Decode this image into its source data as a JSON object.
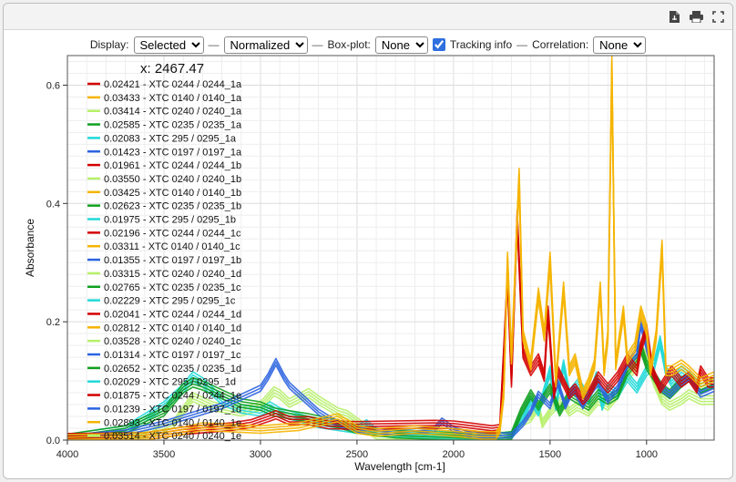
{
  "toolbar": {
    "display_label": "Display:",
    "display_value": "Selected",
    "sep1": "—",
    "mode_value": "Normalized",
    "sep2": "—",
    "boxplot_label": "Box-plot:",
    "boxplot_value": "None",
    "tracking_label": "Tracking info",
    "sep3": "—",
    "correlation_label": "Correlation:",
    "correlation_value": "None"
  },
  "icons": [
    "pdf-export-icon",
    "print-icon",
    "fullscreen-icon"
  ],
  "tracking": {
    "readout": "x: 2467.47"
  },
  "chart_data": {
    "type": "line",
    "xlabel": "Wavelength [cm-1]",
    "ylabel": "Absorbance",
    "xlim": [
      4000,
      650
    ],
    "ylim": [
      0,
      0.65
    ],
    "x_reversed": true,
    "grid": true,
    "legend_position": "top-left",
    "x_ticks": [
      4000,
      3500,
      3000,
      2500,
      2000,
      1500,
      1000
    ],
    "y_ticks": [
      0.0,
      0.2,
      0.4,
      0.6
    ],
    "series": [
      {
        "name": "0.02421 - XTC 0244 / 0244_1a",
        "color": "#d40000"
      },
      {
        "name": "0.03433 - XTC 0140 / 0140_1a",
        "color": "#f5b400"
      },
      {
        "name": "0.03414 - XTC 0240 / 0240_1a",
        "color": "#b7f06a"
      },
      {
        "name": "0.02585 - XTC 0235 / 0235_1a",
        "color": "#10a020"
      },
      {
        "name": "0.02083 - XTC 295 / 0295_1a",
        "color": "#20d8d8"
      },
      {
        "name": "0.01423 - XTC 0197 / 0197_1a",
        "color": "#2b63e0"
      },
      {
        "name": "0.01961 - XTC 0244 / 0244_1b",
        "color": "#d40000"
      },
      {
        "name": "0.03550 - XTC 0240 / 0240_1b",
        "color": "#b7f06a"
      },
      {
        "name": "0.03425 - XTC 0140 / 0140_1b",
        "color": "#f5b400"
      },
      {
        "name": "0.02623 - XTC 0235 / 0235_1b",
        "color": "#10a020"
      },
      {
        "name": "0.01975 - XTC 295 / 0295_1b",
        "color": "#20d8d8"
      },
      {
        "name": "0.02196 - XTC 0244 / 0244_1c",
        "color": "#d40000"
      },
      {
        "name": "0.03311 - XTC 0140 / 0140_1c",
        "color": "#f5b400"
      },
      {
        "name": "0.01355 - XTC 0197 / 0197_1b",
        "color": "#2b63e0"
      },
      {
        "name": "0.03315 - XTC 0240 / 0240_1d",
        "color": "#b7f06a"
      },
      {
        "name": "0.02765 - XTC 0235 / 0235_1c",
        "color": "#10a020"
      },
      {
        "name": "0.02229 - XTC 295 / 0295_1c",
        "color": "#20d8d8"
      },
      {
        "name": "0.02041 - XTC 0244 / 0244_1d",
        "color": "#d40000"
      },
      {
        "name": "0.02812 - XTC 0140 / 0140_1d",
        "color": "#f5b400"
      },
      {
        "name": "0.03528 - XTC 0240 / 0240_1c",
        "color": "#b7f06a"
      },
      {
        "name": "0.01314 - XTC 0197 / 0197_1c",
        "color": "#2b63e0"
      },
      {
        "name": "0.02652 - XTC 0235 / 0235_1d",
        "color": "#10a020"
      },
      {
        "name": "0.02029 - XTC 295 / 0295_1d",
        "color": "#20d8d8"
      },
      {
        "name": "0.01875 - XTC 0244 / 0244_1e",
        "color": "#d40000"
      },
      {
        "name": "0.01239 - XTC 0197 / 0197_1d",
        "color": "#2b63e0"
      },
      {
        "name": "0.02893 - XTC 0140 / 0140_1e",
        "color": "#f5b400"
      },
      {
        "name": "0.03514 - XTC 0240 / 0240_1e",
        "color": "#b7f06a"
      }
    ],
    "group_spectra": {
      "red": [
        [
          4000,
          0.007
        ],
        [
          3600,
          0.008
        ],
        [
          3400,
          0.018
        ],
        [
          3150,
          0.025
        ],
        [
          3050,
          0.03
        ],
        [
          2960,
          0.04
        ],
        [
          2920,
          0.045
        ],
        [
          2850,
          0.035
        ],
        [
          2750,
          0.035
        ],
        [
          2650,
          0.028
        ],
        [
          2500,
          0.027
        ],
        [
          2300,
          0.028
        ],
        [
          2100,
          0.029
        ],
        [
          2000,
          0.028
        ],
        [
          1900,
          0.024
        ],
        [
          1800,
          0.02
        ],
        [
          1760,
          0.022
        ],
        [
          1740,
          0.15
        ],
        [
          1720,
          0.28
        ],
        [
          1700,
          0.1
        ],
        [
          1670,
          0.38
        ],
        [
          1640,
          0.15
        ],
        [
          1600,
          0.12
        ],
        [
          1560,
          0.14
        ],
        [
          1530,
          0.11
        ],
        [
          1510,
          0.22
        ],
        [
          1480,
          0.08
        ],
        [
          1460,
          0.12
        ],
        [
          1400,
          0.08
        ],
        [
          1370,
          0.09
        ],
        [
          1330,
          0.07
        ],
        [
          1300,
          0.08
        ],
        [
          1250,
          0.11
        ],
        [
          1200,
          0.09
        ],
        [
          1150,
          0.11
        ],
        [
          1100,
          0.14
        ],
        [
          1050,
          0.12
        ],
        [
          1030,
          0.16
        ],
        [
          1000,
          0.19
        ],
        [
          970,
          0.12
        ],
        [
          930,
          0.09
        ],
        [
          870,
          0.12
        ],
        [
          820,
          0.1
        ],
        [
          780,
          0.11
        ],
        [
          740,
          0.09
        ],
        [
          720,
          0.12
        ],
        [
          680,
          0.1
        ],
        [
          650,
          0.1
        ]
      ],
      "yellow": [
        [
          4000,
          0.005
        ],
        [
          3600,
          0.008
        ],
        [
          3400,
          0.018
        ],
        [
          3300,
          0.025
        ],
        [
          3000,
          0.02
        ],
        [
          2800,
          0.025
        ],
        [
          2600,
          0.04
        ],
        [
          2500,
          0.02
        ],
        [
          2400,
          0.015
        ],
        [
          2200,
          0.02
        ],
        [
          2000,
          0.015
        ],
        [
          1850,
          0.01
        ],
        [
          1780,
          0.01
        ],
        [
          1760,
          0.02
        ],
        [
          1740,
          0.08
        ],
        [
          1720,
          0.31
        ],
        [
          1700,
          0.14
        ],
        [
          1660,
          0.45
        ],
        [
          1640,
          0.18
        ],
        [
          1600,
          0.13
        ],
        [
          1560,
          0.25
        ],
        [
          1530,
          0.18
        ],
        [
          1500,
          0.31
        ],
        [
          1470,
          0.1
        ],
        [
          1430,
          0.26
        ],
        [
          1400,
          0.12
        ],
        [
          1370,
          0.14
        ],
        [
          1330,
          0.08
        ],
        [
          1300,
          0.1
        ],
        [
          1270,
          0.13
        ],
        [
          1240,
          0.26
        ],
        [
          1220,
          0.12
        ],
        [
          1200,
          0.18
        ],
        [
          1180,
          0.64
        ],
        [
          1160,
          0.13
        ],
        [
          1120,
          0.22
        ],
        [
          1100,
          0.14
        ],
        [
          1060,
          0.16
        ],
        [
          1030,
          0.22
        ],
        [
          1000,
          0.19
        ],
        [
          980,
          0.12
        ],
        [
          950,
          0.18
        ],
        [
          920,
          0.33
        ],
        [
          900,
          0.12
        ],
        [
          870,
          0.12
        ],
        [
          820,
          0.13
        ],
        [
          780,
          0.12
        ],
        [
          720,
          0.1
        ],
        [
          650,
          0.11
        ]
      ],
      "lime": [
        [
          4000,
          0.005
        ],
        [
          3600,
          0.01
        ],
        [
          3450,
          0.03
        ],
        [
          3350,
          0.075
        ],
        [
          3250,
          0.06
        ],
        [
          3100,
          0.05
        ],
        [
          3000,
          0.06
        ],
        [
          2930,
          0.085
        ],
        [
          2900,
          0.08
        ],
        [
          2850,
          0.065
        ],
        [
          2750,
          0.082
        ],
        [
          2700,
          0.07
        ],
        [
          2600,
          0.05
        ],
        [
          2550,
          0.045
        ],
        [
          2400,
          0.01
        ],
        [
          2200,
          0.01
        ],
        [
          2000,
          0.01
        ],
        [
          1800,
          0.008
        ],
        [
          1700,
          0.01
        ],
        [
          1660,
          0.03
        ],
        [
          1600,
          0.04
        ],
        [
          1560,
          0.06
        ],
        [
          1540,
          0.03
        ],
        [
          1500,
          0.05
        ],
        [
          1440,
          0.07
        ],
        [
          1400,
          0.05
        ],
        [
          1360,
          0.06
        ],
        [
          1300,
          0.05
        ],
        [
          1250,
          0.07
        ],
        [
          1200,
          0.06
        ],
        [
          1150,
          0.08
        ],
        [
          1100,
          0.11
        ],
        [
          1050,
          0.13
        ],
        [
          1030,
          0.16
        ],
        [
          1000,
          0.14
        ],
        [
          960,
          0.1
        ],
        [
          920,
          0.07
        ],
        [
          880,
          0.06
        ],
        [
          820,
          0.07
        ],
        [
          780,
          0.08
        ],
        [
          720,
          0.07
        ],
        [
          650,
          0.07
        ]
      ],
      "green": [
        [
          4000,
          0.006
        ],
        [
          3700,
          0.02
        ],
        [
          3500,
          0.05
        ],
        [
          3400,
          0.09
        ],
        [
          3350,
          0.1
        ],
        [
          3300,
          0.095
        ],
        [
          3200,
          0.08
        ],
        [
          3100,
          0.065
        ],
        [
          3000,
          0.06
        ],
        [
          2930,
          0.05
        ],
        [
          2850,
          0.045
        ],
        [
          2750,
          0.04
        ],
        [
          2600,
          0.03
        ],
        [
          2500,
          0.02
        ],
        [
          2300,
          0.012
        ],
        [
          2000,
          0.008
        ],
        [
          1800,
          0.006
        ],
        [
          1700,
          0.01
        ],
        [
          1650,
          0.05
        ],
        [
          1600,
          0.08
        ],
        [
          1560,
          0.06
        ],
        [
          1500,
          0.09
        ],
        [
          1450,
          0.05
        ],
        [
          1400,
          0.08
        ],
        [
          1350,
          0.07
        ],
        [
          1300,
          0.06
        ],
        [
          1250,
          0.08
        ],
        [
          1200,
          0.07
        ],
        [
          1150,
          0.08
        ],
        [
          1100,
          0.12
        ],
        [
          1050,
          0.14
        ],
        [
          1030,
          0.16
        ],
        [
          1000,
          0.13
        ],
        [
          960,
          0.11
        ],
        [
          920,
          0.09
        ],
        [
          880,
          0.08
        ],
        [
          820,
          0.1
        ],
        [
          780,
          0.11
        ],
        [
          720,
          0.09
        ],
        [
          650,
          0.1
        ]
      ],
      "cyan": [
        [
          4000,
          0.006
        ],
        [
          3700,
          0.02
        ],
        [
          3500,
          0.06
        ],
        [
          3400,
          0.09
        ],
        [
          3350,
          0.11
        ],
        [
          3300,
          0.1
        ],
        [
          3200,
          0.07
        ],
        [
          3100,
          0.055
        ],
        [
          3000,
          0.05
        ],
        [
          2950,
          0.06
        ],
        [
          2900,
          0.05
        ],
        [
          2800,
          0.04
        ],
        [
          2700,
          0.03
        ],
        [
          2500,
          0.02
        ],
        [
          2450,
          0.03
        ],
        [
          2400,
          0.015
        ],
        [
          2200,
          0.012
        ],
        [
          2000,
          0.01
        ],
        [
          1800,
          0.006
        ],
        [
          1700,
          0.01
        ],
        [
          1640,
          0.04
        ],
        [
          1600,
          0.07
        ],
        [
          1560,
          0.05
        ],
        [
          1500,
          0.12
        ],
        [
          1470,
          0.06
        ],
        [
          1430,
          0.13
        ],
        [
          1400,
          0.08
        ],
        [
          1350,
          0.1
        ],
        [
          1300,
          0.07
        ],
        [
          1260,
          0.11
        ],
        [
          1230,
          0.06
        ],
        [
          1200,
          0.09
        ],
        [
          1150,
          0.08
        ],
        [
          1100,
          0.11
        ],
        [
          1050,
          0.09
        ],
        [
          1000,
          0.12
        ],
        [
          960,
          0.13
        ],
        [
          930,
          0.17
        ],
        [
          900,
          0.12
        ],
        [
          870,
          0.1
        ],
        [
          820,
          0.12
        ],
        [
          780,
          0.11
        ],
        [
          720,
          0.09
        ],
        [
          650,
          0.1
        ]
      ],
      "blue": [
        [
          4000,
          0.006
        ],
        [
          3700,
          0.015
        ],
        [
          3500,
          0.03
        ],
        [
          3300,
          0.05
        ],
        [
          3200,
          0.06
        ],
        [
          3100,
          0.075
        ],
        [
          3000,
          0.09
        ],
        [
          2960,
          0.11
        ],
        [
          2920,
          0.135
        ],
        [
          2880,
          0.11
        ],
        [
          2850,
          0.095
        ],
        [
          2800,
          0.08
        ],
        [
          2700,
          0.05
        ],
        [
          2600,
          0.03
        ],
        [
          2500,
          0.02
        ],
        [
          2300,
          0.015
        ],
        [
          2100,
          0.02
        ],
        [
          2060,
          0.035
        ],
        [
          2000,
          0.02
        ],
        [
          1900,
          0.01
        ],
        [
          1700,
          0.01
        ],
        [
          1640,
          0.03
        ],
        [
          1600,
          0.05
        ],
        [
          1560,
          0.08
        ],
        [
          1500,
          0.06
        ],
        [
          1460,
          0.1
        ],
        [
          1420,
          0.06
        ],
        [
          1380,
          0.09
        ],
        [
          1330,
          0.06
        ],
        [
          1300,
          0.08
        ],
        [
          1250,
          0.1
        ],
        [
          1200,
          0.07
        ],
        [
          1150,
          0.09
        ],
        [
          1100,
          0.13
        ],
        [
          1050,
          0.15
        ],
        [
          1030,
          0.2
        ],
        [
          1000,
          0.16
        ],
        [
          960,
          0.11
        ],
        [
          920,
          0.09
        ],
        [
          880,
          0.08
        ],
        [
          820,
          0.1
        ],
        [
          780,
          0.11
        ],
        [
          720,
          0.08
        ],
        [
          650,
          0.09
        ]
      ]
    },
    "tracking_x": 2467.47
  }
}
